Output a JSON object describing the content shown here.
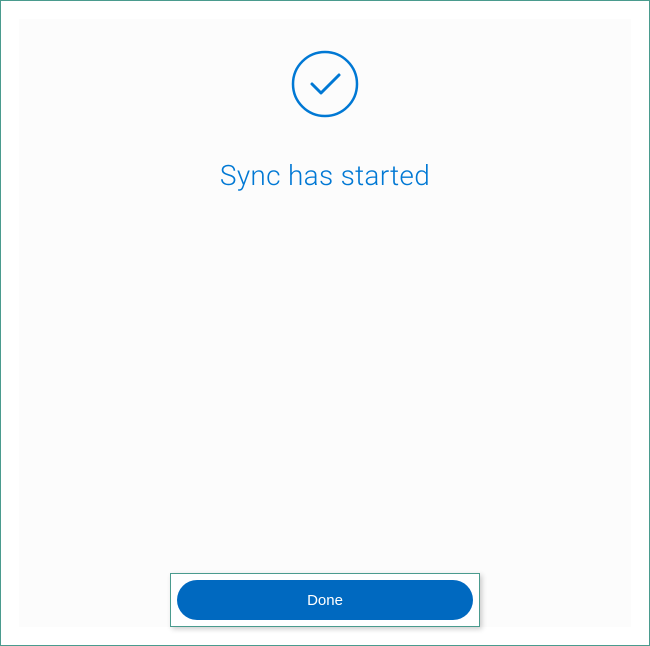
{
  "status": {
    "title": "Sync has started"
  },
  "actions": {
    "done_label": "Done"
  },
  "colors": {
    "accent": "#0078d4",
    "button": "#0069c0",
    "frame": "#4a9b8e"
  }
}
